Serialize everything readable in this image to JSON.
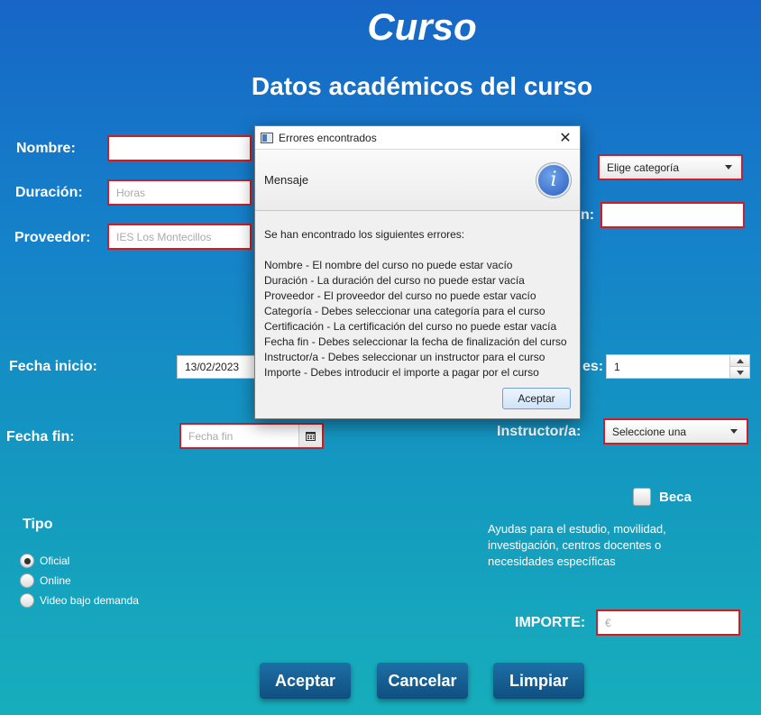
{
  "header": {
    "title": "Curso",
    "subtitle": "Datos académicos del curso"
  },
  "form": {
    "nombre_label": "Nombre:",
    "duracion_label": "Duración:",
    "duracion_placeholder": "Horas",
    "proveedor_label": "Proveedor:",
    "proveedor_placeholder": "IES Los Montecillos",
    "categoria_value": "Elige categoría",
    "certificacion_label_fragment": "n:",
    "fecha_inicio_label": "Fecha inicio:",
    "fecha_inicio_value": "13/02/2023",
    "plazas_label_fragment": "es:",
    "plazas_value": "1",
    "fecha_fin_label": "Fecha fin:",
    "fecha_fin_placeholder": "Fecha fin",
    "instructor_label": "Instructor/a:",
    "instructor_value": "Seleccione una",
    "beca_label": "Beca",
    "beca_desc": "Ayudas para el estudio, movilidad, investigación, centros docentes o necesidades específicas",
    "tipo_label": "Tipo",
    "tipo_options": [
      "Oficial",
      "Online",
      "Video bajo demanda"
    ],
    "tipo_selected": "Oficial",
    "importe_label": "IMPORTE:",
    "importe_placeholder": "€"
  },
  "buttons": {
    "accept": "Aceptar",
    "cancel": "Cancelar",
    "clear": "Limpiar"
  },
  "dialog": {
    "title": "Errores encontrados",
    "header": "Mensaje",
    "intro": "Se han encontrado los siguientes errores:",
    "errors": [
      "Nombre - El nombre del curso no puede estar vacío",
      "Duración - La duración del curso no puede estar vacía",
      "Proveedor - El proveedor del curso no puede estar vacío",
      "Categoría - Debes seleccionar una categoría para el curso",
      "Certificación - La certificación del curso no puede estar vacía",
      "Fecha fin - Debes seleccionar la fecha de finalización del curso",
      "Instructor/a - Debes seleccionar un instructor para el curso",
      "Importe - Debes introducir el importe a pagar por el curso"
    ],
    "ok": "Aceptar"
  },
  "colors": {
    "error_border": "#d01c22",
    "button_bg": "#135c90",
    "bg_top": "#1766c6",
    "bg_bottom": "#17aebc"
  }
}
